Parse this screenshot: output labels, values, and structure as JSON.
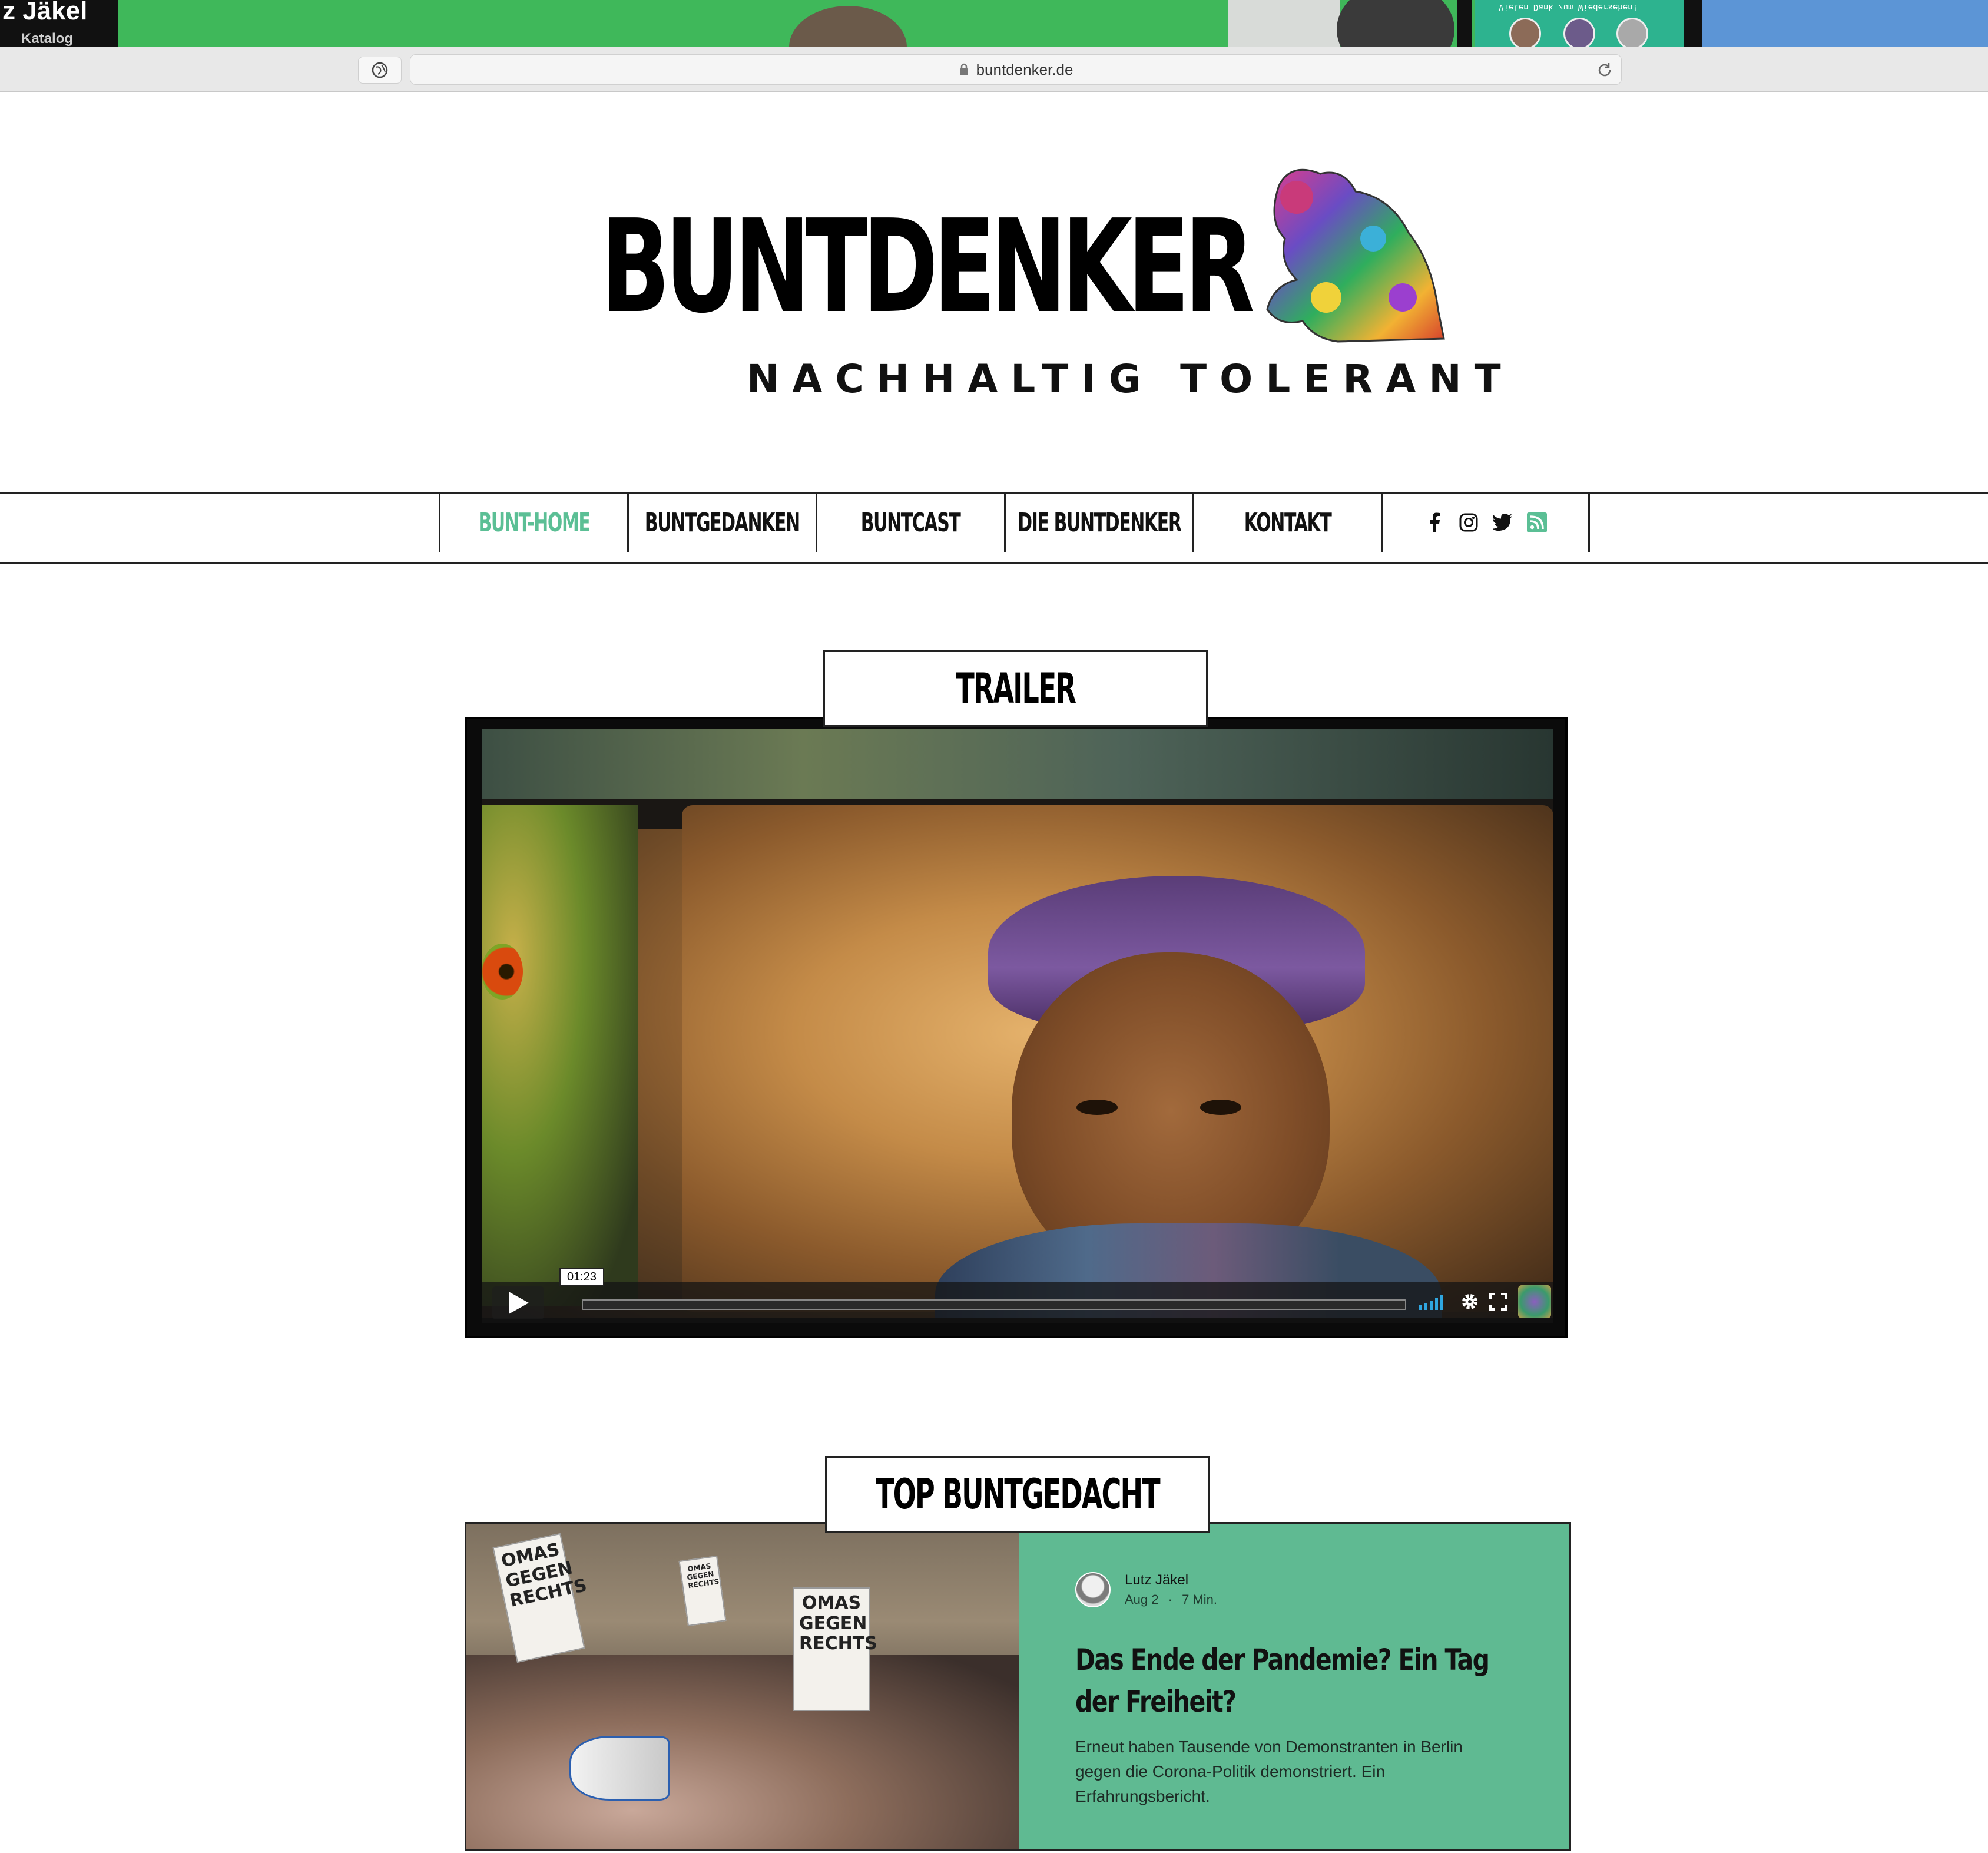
{
  "top_strip": {
    "name_fragment": "z Jäkel",
    "katalog_label": "Katalog",
    "teal_caption": "Vielen Dank zum Wiedersehen!"
  },
  "browser": {
    "url": "buntdenker.de"
  },
  "logo": {
    "title": "BUNTDENKER",
    "subtitle": "NACHHALTIG TOLERANT"
  },
  "nav": {
    "items": [
      {
        "label": "BUNT-HOME",
        "active": true
      },
      {
        "label": "BUNTGEDANKEN",
        "active": false
      },
      {
        "label": "BUNTCAST",
        "active": false
      },
      {
        "label": "DIE BUNTDENKER",
        "active": false
      },
      {
        "label": "KONTAKT",
        "active": false
      }
    ],
    "social_icons": [
      "facebook-icon",
      "instagram-icon",
      "twitter-icon",
      "rss-icon"
    ],
    "active_color": "#5bbf95",
    "rss_color": "#5bbf95"
  },
  "trailer": {
    "heading": "TRAILER",
    "time_tooltip": "01:23"
  },
  "top_post": {
    "heading": "TOP BUNTGEDACHT",
    "author": "Lutz Jäkel",
    "date": "Aug 2",
    "read_time": "7 Min.",
    "separator": "·",
    "title": "Das Ende der Pandemie? Ein Tag der Freiheit?",
    "excerpt": "Erneut haben Tausende von Demonstranten in Berlin gegen die Corona-Politik demonstriert. Ein Erfahrungsbericht.",
    "card_color": "#5fba92",
    "image_signs": [
      "OMAS GEGEN RECHTS",
      "OMAS GEGEN RECHTS",
      "OMAS GEGEN RECHTS"
    ]
  }
}
